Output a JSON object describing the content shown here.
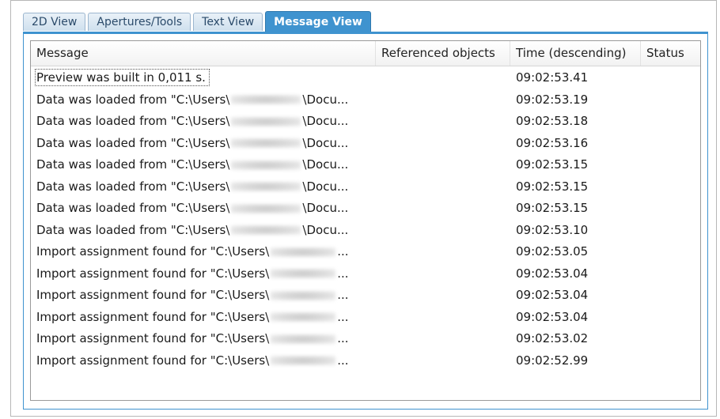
{
  "tabs": [
    {
      "label": "2D View",
      "active": false
    },
    {
      "label": "Apertures/Tools",
      "active": false
    },
    {
      "label": "Text View",
      "active": false
    },
    {
      "label": "Message View",
      "active": true
    }
  ],
  "columns": {
    "message": "Message",
    "referenced": "Referenced objects",
    "time": "Time (descending)",
    "status": "Status"
  },
  "rows": [
    {
      "message_start": "Preview was built in 0,011 s.",
      "message_end": "",
      "redacted": false,
      "referenced": "",
      "time": "09:02:53.41",
      "status": ""
    },
    {
      "message_start": "Data was loaded from \"C:\\Users\\",
      "message_end": "\\Docu...",
      "redacted": true,
      "referenced": "",
      "time": "09:02:53.19",
      "status": ""
    },
    {
      "message_start": "Data was loaded from \"C:\\Users\\",
      "message_end": "\\Docu...",
      "redacted": true,
      "referenced": "",
      "time": "09:02:53.18",
      "status": ""
    },
    {
      "message_start": "Data was loaded from \"C:\\Users\\",
      "message_end": "\\Docu...",
      "redacted": true,
      "referenced": "",
      "time": "09:02:53.16",
      "status": ""
    },
    {
      "message_start": "Data was loaded from \"C:\\Users\\",
      "message_end": "\\Docu...",
      "redacted": true,
      "referenced": "",
      "time": "09:02:53.15",
      "status": ""
    },
    {
      "message_start": "Data was loaded from \"C:\\Users\\",
      "message_end": "\\Docu...",
      "redacted": true,
      "referenced": "",
      "time": "09:02:53.15",
      "status": ""
    },
    {
      "message_start": "Data was loaded from \"C:\\Users\\",
      "message_end": "\\Docu...",
      "redacted": true,
      "referenced": "",
      "time": "09:02:53.15",
      "status": ""
    },
    {
      "message_start": "Data was loaded from \"C:\\Users\\",
      "message_end": "\\Docu...",
      "redacted": true,
      "referenced": "",
      "time": "09:02:53.10",
      "status": ""
    },
    {
      "message_start": "Import assignment found for \"C:\\Users\\",
      "message_end": "...",
      "redacted": true,
      "referenced": "",
      "time": "09:02:53.05",
      "status": ""
    },
    {
      "message_start": "Import assignment found for \"C:\\Users\\",
      "message_end": "...",
      "redacted": true,
      "referenced": "",
      "time": "09:02:53.04",
      "status": ""
    },
    {
      "message_start": "Import assignment found for \"C:\\Users\\",
      "message_end": "...",
      "redacted": true,
      "referenced": "",
      "time": "09:02:53.04",
      "status": ""
    },
    {
      "message_start": "Import assignment found for \"C:\\Users\\",
      "message_end": "...",
      "redacted": true,
      "referenced": "",
      "time": "09:02:53.04",
      "status": ""
    },
    {
      "message_start": "Import assignment found for \"C:\\Users\\",
      "message_end": "...",
      "redacted": true,
      "referenced": "",
      "time": "09:02:53.02",
      "status": ""
    },
    {
      "message_start": "Import assignment found for \"C:\\Users\\",
      "message_end": "...",
      "redacted": true,
      "referenced": "",
      "time": "09:02:52.99",
      "status": ""
    }
  ]
}
